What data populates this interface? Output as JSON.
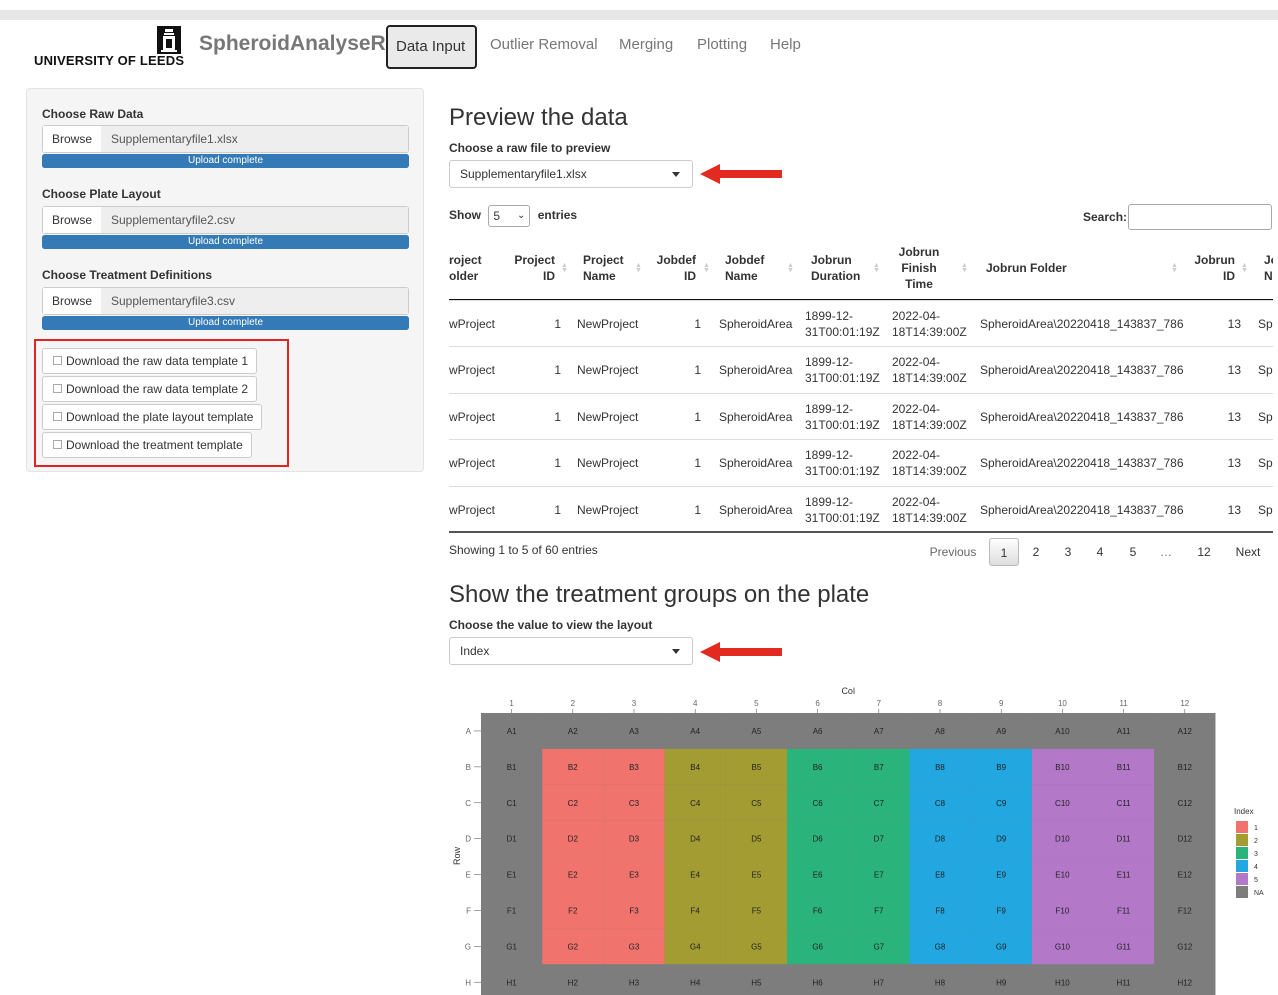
{
  "nav": {
    "university": "UNIVERSITY OF LEEDS",
    "app_title": "SpheroidAnalyseR",
    "tabs": [
      {
        "label": "Data Input",
        "active": true
      },
      {
        "label": "Outlier Removal"
      },
      {
        "label": "Merging"
      },
      {
        "label": "Plotting"
      },
      {
        "label": "Help"
      }
    ]
  },
  "sidebar": {
    "uploads": [
      {
        "label": "Choose Raw Data",
        "button": "Browse",
        "file": "Supplementaryfile1.xlsx",
        "status": "Upload complete",
        "progress": 1.0
      },
      {
        "label": "Choose Plate Layout",
        "button": "Browse",
        "file": "Supplementaryfile2.csv",
        "status": "Upload complete",
        "progress": 1.0
      },
      {
        "label": "Choose Treatment Definitions",
        "button": "Browse",
        "file": "Supplementaryfile3.csv",
        "status": "Upload complete",
        "progress": 1.0
      }
    ],
    "downloads": [
      "Download the raw data template 1",
      "Download the raw data template 2",
      "Download the plate layout template",
      "Download the treatment template"
    ]
  },
  "preview": {
    "title": "Preview the data",
    "file_label": "Choose a raw file to preview",
    "file_selected": "Supplementaryfile1.xlsx",
    "show_label": "Show",
    "entries_value": "5",
    "entries_label": "entries",
    "search_label": "Search:",
    "columns": [
      [
        "roject",
        "older"
      ],
      [
        "Project",
        "ID"
      ],
      [
        "Project",
        "Name"
      ],
      [
        "Jobdef",
        "ID"
      ],
      [
        "Jobdef",
        "Name"
      ],
      [
        "Jobrun",
        "Duration"
      ],
      [
        "Jobrun",
        "Finish",
        "Time"
      ],
      [
        "Jobrun Folder"
      ],
      [
        "Jobrun",
        "ID"
      ],
      [
        "Jo",
        "N"
      ]
    ],
    "rows": [
      {
        "c0": "wProject",
        "c1": "1",
        "c2": "NewProject",
        "c3": "1",
        "c4": "SpheroidArea",
        "c5a": "1899-12-",
        "c5b": "31T00:01:19Z",
        "c6a": "2022-04-",
        "c6b": "18T14:39:00Z",
        "c7": "SpheroidArea\\20220418_143837_786",
        "c8": "13",
        "c9": "Sp"
      },
      {
        "c0": "wProject",
        "c1": "1",
        "c2": "NewProject",
        "c3": "1",
        "c4": "SpheroidArea",
        "c5a": "1899-12-",
        "c5b": "31T00:01:19Z",
        "c6a": "2022-04-",
        "c6b": "18T14:39:00Z",
        "c7": "SpheroidArea\\20220418_143837_786",
        "c8": "13",
        "c9": "Sp"
      },
      {
        "c0": "wProject",
        "c1": "1",
        "c2": "NewProject",
        "c3": "1",
        "c4": "SpheroidArea",
        "c5a": "1899-12-",
        "c5b": "31T00:01:19Z",
        "c6a": "2022-04-",
        "c6b": "18T14:39:00Z",
        "c7": "SpheroidArea\\20220418_143837_786",
        "c8": "13",
        "c9": "Sp"
      },
      {
        "c0": "wProject",
        "c1": "1",
        "c2": "NewProject",
        "c3": "1",
        "c4": "SpheroidArea",
        "c5a": "1899-12-",
        "c5b": "31T00:01:19Z",
        "c6a": "2022-04-",
        "c6b": "18T14:39:00Z",
        "c7": "SpheroidArea\\20220418_143837_786",
        "c8": "13",
        "c9": "Sp"
      },
      {
        "c0": "wProject",
        "c1": "1",
        "c2": "NewProject",
        "c3": "1",
        "c4": "SpheroidArea",
        "c5a": "1899-12-",
        "c5b": "31T00:01:19Z",
        "c6a": "2022-04-",
        "c6b": "18T14:39:00Z",
        "c7": "SpheroidArea\\20220418_143837_786",
        "c8": "13",
        "c9": "Sp"
      }
    ],
    "info": "Showing 1 to 5 of 60 entries",
    "pager": {
      "previous": "Previous",
      "pages": [
        "1",
        "2",
        "3",
        "4",
        "5",
        "…",
        "12"
      ],
      "next": "Next",
      "current": "1"
    }
  },
  "layout": {
    "title": "Show the treatment groups on the plate",
    "value_label": "Choose the value to view the layout",
    "value_selected": "Index"
  },
  "chart_data": {
    "type": "heatmap",
    "xlabel": "Col",
    "ylabel": "Row",
    "x": [
      "1",
      "2",
      "3",
      "4",
      "5",
      "6",
      "7",
      "8",
      "9",
      "10",
      "11",
      "12"
    ],
    "y": [
      "A",
      "B",
      "C",
      "D",
      "E",
      "F",
      "G",
      "H"
    ],
    "legend_title": "Index",
    "legend_placement": "right",
    "legend": [
      {
        "label": "1",
        "color": "#f0736d"
      },
      {
        "label": "2",
        "color": "#a39c32"
      },
      {
        "label": "3",
        "color": "#2bb37c"
      },
      {
        "label": "4",
        "color": "#22a7e0"
      },
      {
        "label": "5",
        "color": "#b478c8"
      },
      {
        "label": "NA",
        "color": "#7d7d7d"
      }
    ],
    "column_groups": [
      {
        "cols": [
          "2",
          "3"
        ],
        "rows": [
          "B",
          "C",
          "D",
          "E",
          "F",
          "G"
        ],
        "index": "1"
      },
      {
        "cols": [
          "4",
          "5"
        ],
        "rows": [
          "B",
          "C",
          "D",
          "E",
          "F",
          "G"
        ],
        "index": "2"
      },
      {
        "cols": [
          "6",
          "7"
        ],
        "rows": [
          "B",
          "C",
          "D",
          "E",
          "F",
          "G"
        ],
        "index": "3"
      },
      {
        "cols": [
          "8",
          "9"
        ],
        "rows": [
          "B",
          "C",
          "D",
          "E",
          "F",
          "G"
        ],
        "index": "4"
      },
      {
        "cols": [
          "10",
          "11"
        ],
        "rows": [
          "B",
          "C",
          "D",
          "E",
          "F",
          "G"
        ],
        "index": "5"
      }
    ],
    "default_index": "NA"
  }
}
